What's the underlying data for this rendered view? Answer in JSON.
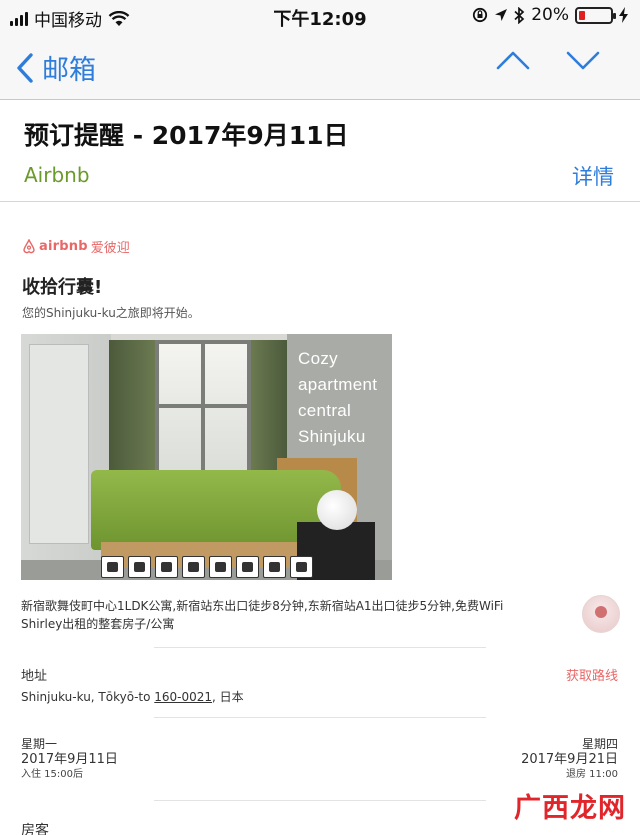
{
  "status_bar": {
    "carrier": "中国移动",
    "time": "下午12:09",
    "battery_text": "20%",
    "battery_level": 0.2,
    "battery_color": "#e02020",
    "icons": [
      "signal-icon",
      "wifi-icon",
      "rotation-lock-icon",
      "location-icon",
      "bluetooth-icon",
      "battery-icon"
    ]
  },
  "nav": {
    "back_label": "邮箱",
    "accent_color": "#2f7ddb"
  },
  "mail": {
    "subject": "预订提醒 - 2017年9月11日",
    "sender": "Airbnb",
    "details_label": "详情"
  },
  "content": {
    "logo_brand": "airbnb",
    "logo_tag": "爱彼迎",
    "heading": "收拾行囊!",
    "subheading": "您的Shinjuku-ku之旅即将开始。",
    "photo_overlay": [
      "Cozy",
      "apartment",
      "central",
      "Shinjuku"
    ],
    "listing_title": "新宿歌舞伎町中心1LDK公寓,新宿站东出口徒步8分钟,东新宿站A1出口徒步5分钟,免费WiFi",
    "listing_host": "Shirley出租的整套房子/公寓",
    "address_label": "地址",
    "route_label": "获取路线",
    "address_prefix": "Shinjuku-ku, Tōkyō-to ",
    "address_zip": "160-0021",
    "address_suffix": ", 日本",
    "checkin": {
      "weekday": "星期一",
      "date": "2017年9月11日",
      "time": "入住 15:00后"
    },
    "checkout": {
      "weekday": "星期四",
      "date": "2017年9月21日",
      "time": "退房 11:00"
    },
    "guests_label": "房客"
  },
  "watermark": "广西龙网"
}
